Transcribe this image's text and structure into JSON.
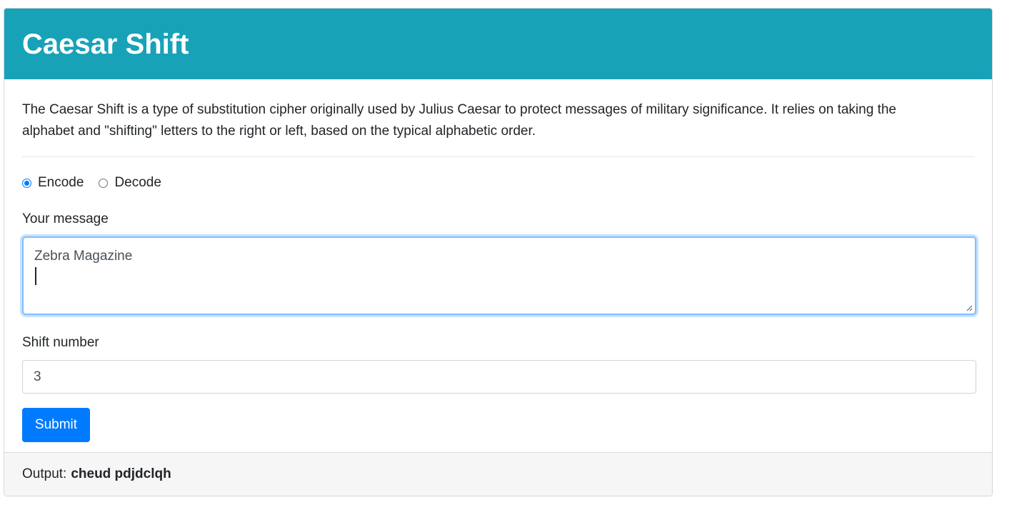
{
  "header": {
    "title": "Caesar Shift"
  },
  "intro": {
    "description": "The Caesar Shift is a type of substitution cipher originally used by Julius Caesar to protect messages of military significance. It relies on taking the alphabet and \"shifting\" letters to the right or left, based on the typical alphabetic order."
  },
  "mode": {
    "options": [
      {
        "label": "Encode",
        "checked": true
      },
      {
        "label": "Decode",
        "checked": false
      }
    ]
  },
  "form": {
    "message_label": "Your message",
    "message_value": "Zebra Magazine",
    "shift_label": "Shift number",
    "shift_value": "3",
    "submit_label": "Submit"
  },
  "output": {
    "label": "Output:",
    "value": "cheud pdjdclqh"
  },
  "colors": {
    "header_bg": "#17a2b8",
    "primary": "#007bff",
    "footer_bg": "#f6f6f6"
  }
}
